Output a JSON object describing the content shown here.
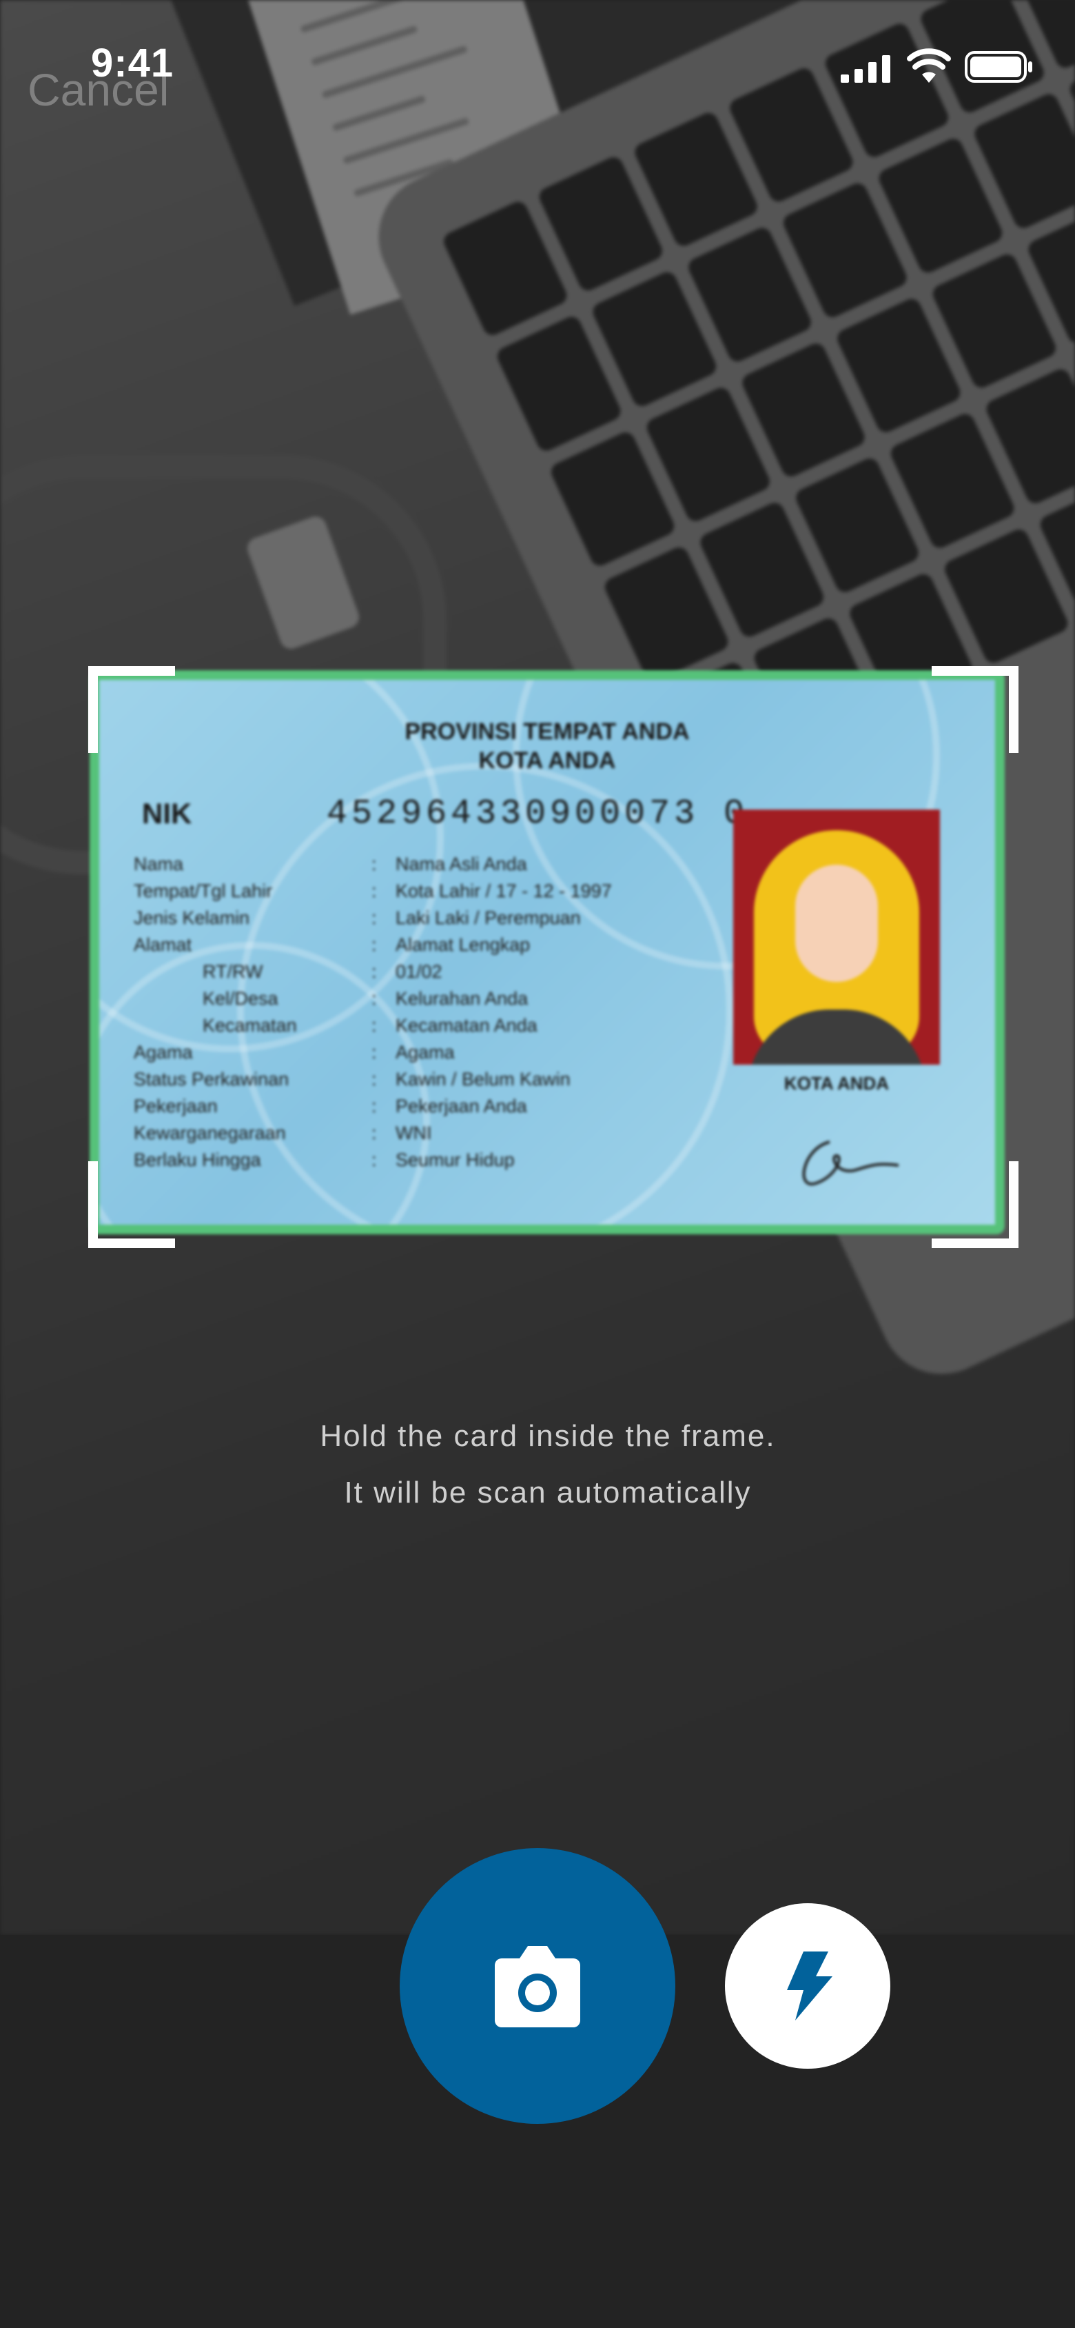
{
  "status_bar": {
    "time": "9:41"
  },
  "nav": {
    "cancel_label": "Cancel"
  },
  "id_card": {
    "province": "PROVINSI TEMPAT ANDA",
    "city": "KOTA ANDA",
    "nik_label": "NIK",
    "nik_value": "452964330900073 0",
    "fields": [
      {
        "label": "Nama",
        "value": "Nama Asli Anda"
      },
      {
        "label": "Tempat/Tgl Lahir",
        "value": "Kota Lahir / 17 - 12 - 1997"
      },
      {
        "label": "Jenis Kelamin",
        "value": "Laki Laki / Perempuan"
      },
      {
        "label": "Alamat",
        "value": "Alamat Lengkap"
      },
      {
        "label": "RT/RW",
        "value": "01/02"
      },
      {
        "label": "Kel/Desa",
        "value": "Kelurahan Anda"
      },
      {
        "label": "Kecamatan",
        "value": "Kecamatan Anda"
      },
      {
        "label": "Agama",
        "value": "Agama"
      },
      {
        "label": "Status Perkawinan",
        "value": "Kawin / Belum Kawin"
      },
      {
        "label": "Pekerjaan",
        "value": "Pekerjaan Anda"
      },
      {
        "label": "Kewarganegaraan",
        "value": "WNI"
      },
      {
        "label": "Berlaku Hingga",
        "value": "Seumur Hidup"
      }
    ],
    "photo_city": "KOTA ANDA",
    "colors": {
      "border": "#56c27a",
      "background": "#9fd3ea",
      "photo_bg": "#a11d22"
    }
  },
  "instructions": {
    "line1": "Hold the card inside the frame.",
    "line2": "It will be scan automatically"
  },
  "controls": {
    "capture_icon": "camera-icon",
    "flash_icon": "flash-icon",
    "accent_color": "#02629b"
  }
}
